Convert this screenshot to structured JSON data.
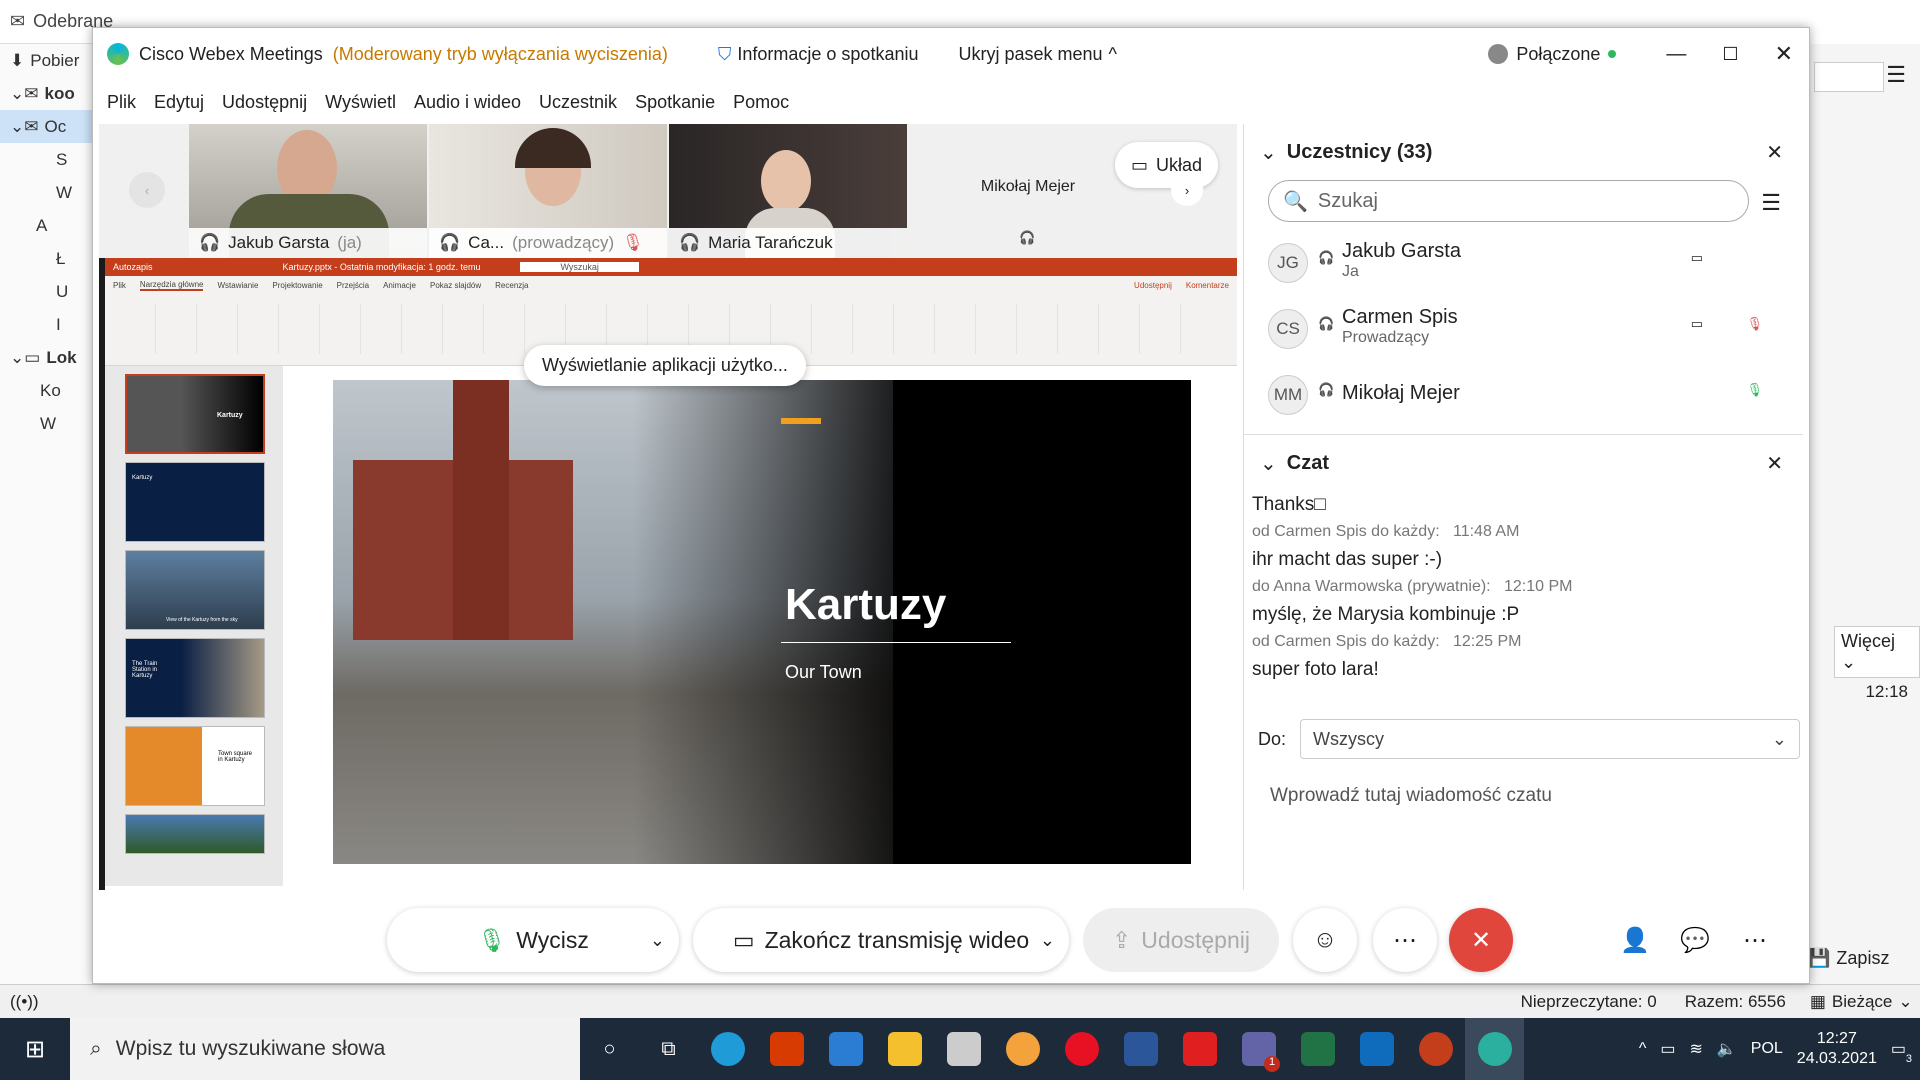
{
  "outlook": {
    "title": "Odebrane",
    "nav_items": [
      "Pobier",
      "koo",
      "Oc",
      "S",
      "W",
      "A",
      "Ł",
      "U",
      "I",
      "Lok",
      "Ko",
      "W"
    ],
    "right_more": "Więcej",
    "right_time": "12:18",
    "save_label": "Zapisz",
    "status_unread": "Nieprzeczytane: 0",
    "status_total": "Razem: 6556",
    "status_current": "Bieżące"
  },
  "taskbar": {
    "search_placeholder": "Wpisz tu wyszukiwane słowa",
    "lang": "POL",
    "time": "12:27",
    "date": "24.03.2021",
    "notif_count": "3",
    "teams_badge": "1"
  },
  "webex": {
    "app_name": "Cisco Webex Meetings",
    "mode": "(Moderowany tryb wyłączania wyciszenia)",
    "info_label": "Informacje o spotkaniu",
    "hide_menu_label": "Ukryj pasek menu",
    "status": "Połączone",
    "menu": [
      "Plik",
      "Edytuj",
      "Udostępnij",
      "Wyświetl",
      "Audio i wideo",
      "Uczestnik",
      "Spotkanie",
      "Pomoc"
    ],
    "layout_label": "Układ",
    "thumbnails": [
      {
        "name": "Jakub Garsta",
        "suffix": "(ja)"
      },
      {
        "name": "Ca...",
        "suffix": "(prowadzący)"
      },
      {
        "name": "Maria Tarańczuk",
        "suffix": ""
      },
      {
        "name": "Mikołaj Mejer",
        "suffix": ""
      }
    ],
    "sharing_bubble": "Wyświetlanie aplikacji użytko...",
    "ppt": {
      "title_bar": "Kartuzy.pptx - Ostatnia modyfikacja: 1 godz. temu",
      "search": "Wyszukaj",
      "autosave": "Autozapis",
      "tabs": [
        "Plik",
        "Narzędzia główne",
        "Wstawianie",
        "Projektowanie",
        "Przejścia",
        "Animacje",
        "Pokaz slajdów",
        "Recenzja"
      ],
      "share_btn": "Udostępnij",
      "comments_btn": "Komentarze",
      "slide_title": "Kartuzy",
      "slide_subtitle": "Our Town",
      "thumb_titles": [
        "Kartuzy",
        "Kartuzy",
        "View of the Kartuzy from the sky",
        "The Train Station in Kartuzy",
        "Town square in Kartuzy",
        ""
      ]
    },
    "participants": {
      "title": "Uczestnicy (33)",
      "search_placeholder": "Szukaj",
      "list": [
        {
          "initials": "JG",
          "name": "Jakub Garsta",
          "role": "Ja"
        },
        {
          "initials": "CS",
          "name": "Carmen Spis",
          "role": "Prowadzący"
        },
        {
          "initials": "MM",
          "name": "Mikołaj Mejer",
          "role": ""
        }
      ]
    },
    "chat": {
      "title": "Czat",
      "messages": [
        {
          "text": "Thanks□",
          "meta": "od Carmen Spis do każdy:",
          "time": "11:48 AM"
        },
        {
          "text": "ihr macht das super :-)",
          "meta": "do Anna Warmowska (prywatnie):",
          "time": "12:10 PM"
        },
        {
          "text": "myślę, że Marysia kombinuje :P",
          "meta": "od Carmen Spis do każdy:",
          "time": "12:25 PM"
        },
        {
          "text": "super foto lara!",
          "meta": "",
          "time": ""
        }
      ],
      "to_label": "Do:",
      "to_value": "Wszyscy",
      "input_placeholder": "Wprowadź tutaj wiadomość czatu"
    },
    "controls": {
      "mute": "Wycisz",
      "stop_video": "Zakończ transmisję wideo",
      "share": "Udostępnij"
    }
  }
}
